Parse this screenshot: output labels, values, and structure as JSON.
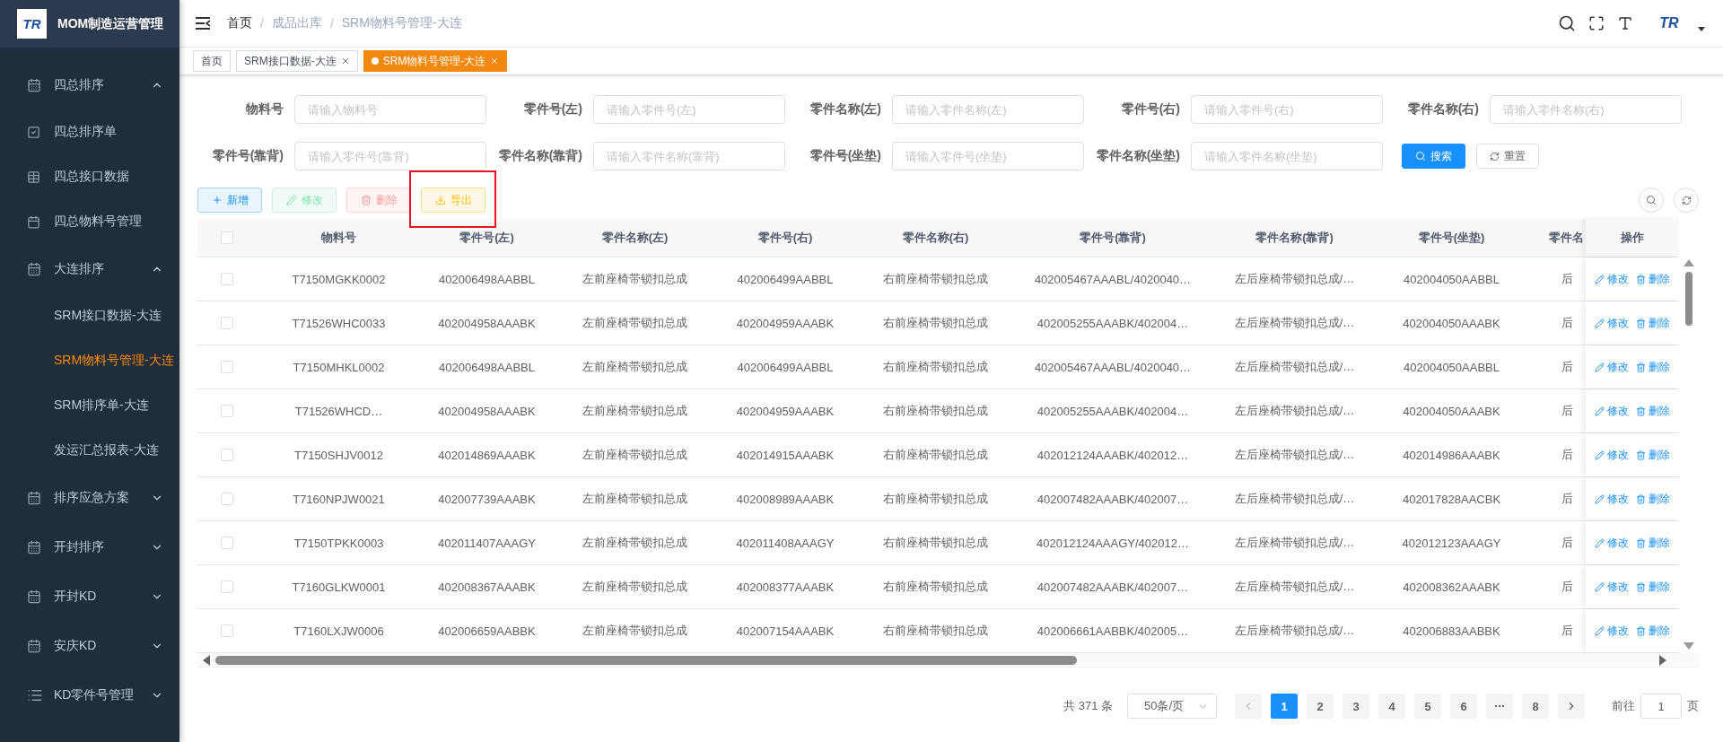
{
  "sidebar": {
    "logo_text": "TR",
    "title": "MOM制造运营管理",
    "menu": [
      {
        "label": "四总排序",
        "expanded": true,
        "children": [
          {
            "label": "四总排序单",
            "kind": "with-icon",
            "selected": false
          },
          {
            "label": "四总接口数据",
            "kind": "with-icon",
            "selected": false
          },
          {
            "label": "四总物料号管理",
            "kind": "with-icon",
            "selected": false
          }
        ]
      },
      {
        "label": "大连排序",
        "expanded": true,
        "children": [
          {
            "label": "SRM接口数据-大连",
            "kind": "plain",
            "selected": false
          },
          {
            "label": "SRM物料号管理-大连",
            "kind": "plain",
            "selected": true
          },
          {
            "label": "SRM排序单-大连",
            "kind": "plain",
            "selected": false
          },
          {
            "label": "发运汇总报表-大连",
            "kind": "plain",
            "selected": false
          }
        ]
      },
      {
        "label": "排序应急方案",
        "expanded": false
      },
      {
        "label": "开封排序",
        "expanded": false
      },
      {
        "label": "开封KD",
        "expanded": false
      },
      {
        "label": "安庆KD",
        "expanded": false
      },
      {
        "label": "KD零件号管理",
        "expanded": false
      }
    ]
  },
  "header": {
    "breadcrumb": [
      "首页",
      "成品出库",
      "SRM物料号管理-大连"
    ],
    "breadcrumb_separators": [
      "/",
      "/"
    ],
    "avatar_text": "TR"
  },
  "tabs": [
    {
      "label": "首页",
      "selected": false,
      "closable": false
    },
    {
      "label": "SRM接口数据-大连",
      "selected": false,
      "closable": true
    },
    {
      "label": "SRM物料号管理-大连",
      "selected": true,
      "closable": true
    }
  ],
  "filters": [
    {
      "label": "物料号",
      "placeholder": "请输入物料号"
    },
    {
      "label": "零件号(左)",
      "placeholder": "请输入零件号(左)"
    },
    {
      "label": "零件名称(左)",
      "placeholder": "请输入零件名称(左)"
    },
    {
      "label": "零件号(右)",
      "placeholder": "请输入零件号(右)"
    },
    {
      "label": "零件名称(右)",
      "placeholder": "请输入零件名称(右)"
    },
    {
      "label": "零件号(靠背)",
      "placeholder": "请输入零件号(靠背)"
    },
    {
      "label": "零件名称(靠背)",
      "placeholder": "请输入零件名称(靠背)"
    },
    {
      "label": "零件号(坐垫)",
      "placeholder": "请输入零件号(坐垫)"
    },
    {
      "label": "零件名称(坐垫)",
      "placeholder": "请输入零件名称(坐垫)"
    }
  ],
  "filter_buttons": [
    {
      "kind": "search",
      "label": "搜索"
    },
    {
      "kind": "reset",
      "label": "重置"
    }
  ],
  "toolbar": [
    {
      "kind": "add",
      "label": "新增",
      "disabled": false,
      "highlighted": false
    },
    {
      "kind": "edit",
      "label": "修改",
      "disabled": true,
      "highlighted": false
    },
    {
      "kind": "delete",
      "label": "删除",
      "disabled": true,
      "highlighted": false
    },
    {
      "kind": "export",
      "label": "导出",
      "disabled": false,
      "highlighted": true
    }
  ],
  "table": {
    "columns": [
      "物料号",
      "零件号(左)",
      "零件名称(左)",
      "零件号(右)",
      "零件名称(右)",
      "零件号(靠背)",
      "零件名称(靠背)",
      "零件号(坐垫)",
      "零件名"
    ],
    "action_column": "操作",
    "header_checked": false,
    "rows": [
      {
        "checked": false,
        "cells": [
          "T7150MGKK0002",
          "402006498AABBL",
          "左前座椅带锁扣总成",
          "402006499AABBL",
          "右前座椅带锁扣总成",
          "402005467AAABL/4020040…",
          "左后座椅带锁扣总成/…",
          "402004050AABBL",
          "后"
        ],
        "actions": [
          "修改",
          "删除"
        ]
      },
      {
        "checked": false,
        "cells": [
          "T71526WHC0033",
          "402004958AAABK",
          "左前座椅带锁扣总成",
          "402004959AAABK",
          "右前座椅带锁扣总成",
          "402005255AAABK/402004…",
          "左后座椅带锁扣总成/…",
          "402004050AAABK",
          "后"
        ],
        "actions": [
          "修改",
          "删除"
        ]
      },
      {
        "checked": false,
        "cells": [
          "T7150MHKL0002",
          "402006498AABBL",
          "左前座椅带锁扣总成",
          "402006499AABBL",
          "右前座椅带锁扣总成",
          "402005467AAABL/4020040…",
          "左后座椅带锁扣总成/…",
          "402004050AABBL",
          "后"
        ],
        "actions": [
          "修改",
          "删除"
        ]
      },
      {
        "checked": false,
        "cells": [
          "T71526WHCD…",
          "402004958AAABK",
          "左前座椅带锁扣总成",
          "402004959AAABK",
          "右前座椅带锁扣总成",
          "402005255AAABK/402004…",
          "左后座椅带锁扣总成/…",
          "402004050AAABK",
          "后"
        ],
        "actions": [
          "修改",
          "删除"
        ]
      },
      {
        "checked": false,
        "cells": [
          "T7150SHJV0012",
          "402014869AAABK",
          "左前座椅带锁扣总成",
          "402014915AAABK",
          "右前座椅带锁扣总成",
          "402012124AAABK/402012…",
          "左后座椅带锁扣总成/…",
          "402014986AAABK",
          "后"
        ],
        "actions": [
          "修改",
          "删除"
        ]
      },
      {
        "checked": false,
        "cells": [
          "T7160NPJW0021",
          "402007739AAABK",
          "左前座椅带锁扣总成",
          "402008989AAABK",
          "右前座椅带锁扣总成",
          "402007482AAABK/402007…",
          "左后座椅带锁扣总成/…",
          "402017828AACBK",
          "后"
        ],
        "actions": [
          "修改",
          "删除"
        ]
      },
      {
        "checked": false,
        "cells": [
          "T7150TPKK0003",
          "402011407AAAGY",
          "左前座椅带锁扣总成",
          "402011408AAAGY",
          "右前座椅带锁扣总成",
          "402012124AAAGY/402012…",
          "左后座椅带锁扣总成/…",
          "402012123AAAGY",
          "后"
        ],
        "actions": [
          "修改",
          "删除"
        ]
      },
      {
        "checked": false,
        "cells": [
          "T7160GLKW0001",
          "402008367AAABK",
          "左前座椅带锁扣总成",
          "402008377AAABK",
          "右前座椅带锁扣总成",
          "402007482AAABK/402007…",
          "左后座椅带锁扣总成/…",
          "402008362AAABK",
          "后"
        ],
        "actions": [
          "修改",
          "删除"
        ]
      },
      {
        "checked": false,
        "cells": [
          "T7160LXJW0006",
          "402006659AABBK",
          "左前座椅带锁扣总成",
          "402007154AAABK",
          "右前座椅带锁扣总成",
          "402006661AABBK/402005…",
          "左后座椅带锁扣总成/…",
          "402006883AABBK",
          "后"
        ],
        "actions": [
          "修改",
          "删除"
        ]
      }
    ]
  },
  "pagination": {
    "total": "共 371 条",
    "page_size": "50条/页",
    "pages": [
      {
        "kind": "page",
        "label": "1",
        "selected": true
      },
      {
        "kind": "page",
        "label": "2",
        "selected": false
      },
      {
        "kind": "page",
        "label": "3",
        "selected": false
      },
      {
        "kind": "page",
        "label": "4",
        "selected": false
      },
      {
        "kind": "page",
        "label": "5",
        "selected": false
      },
      {
        "kind": "page",
        "label": "6",
        "selected": false
      },
      {
        "kind": "more",
        "selected": false
      },
      {
        "kind": "page",
        "label": "8",
        "selected": false
      }
    ],
    "jump_label": "前往",
    "jump_value": "1",
    "jump_suffix": "页"
  }
}
